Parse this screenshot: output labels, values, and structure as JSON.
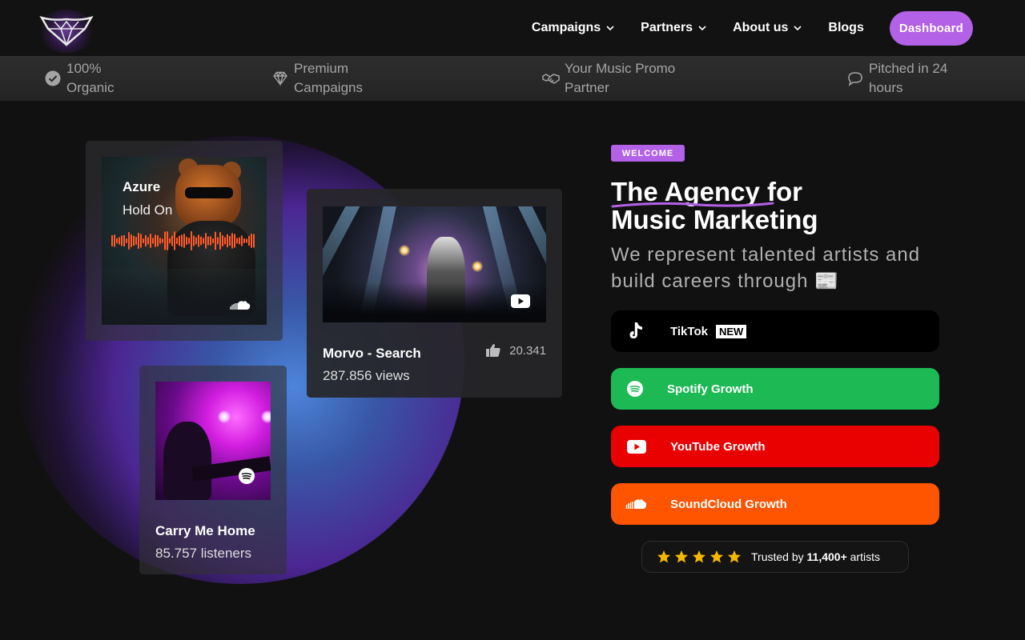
{
  "nav": {
    "items": [
      {
        "label": "Campaigns",
        "has_dropdown": true
      },
      {
        "label": "Partners",
        "has_dropdown": true
      },
      {
        "label": "About us",
        "has_dropdown": true
      },
      {
        "label": "Blogs",
        "has_dropdown": false
      }
    ],
    "cta_label": "Dashboard"
  },
  "features": [
    {
      "icon": "verified-check-icon",
      "line1": "100%",
      "line2": "Organic"
    },
    {
      "icon": "diamond-icon",
      "line1": "Premium",
      "line2": "Campaigns"
    },
    {
      "icon": "handshake-icon",
      "line1": "Your Music Promo",
      "line2": "Partner"
    },
    {
      "icon": "chat-bubble-icon",
      "line1": "Pitched in 24",
      "line2": "hours"
    }
  ],
  "cards": {
    "soundcloud": {
      "artist": "Azure",
      "track": "Hold On"
    },
    "youtube": {
      "title": "Morvo - Search",
      "likes": "20.341",
      "views": "287.856 views"
    },
    "spotify": {
      "title": "Carry Me Home",
      "listeners": "85.757 listeners"
    }
  },
  "hero": {
    "badge": "WELCOME",
    "headline_accent": "The Agency",
    "headline_rest": " for",
    "headline_line2": "Music Marketing",
    "subhead": "We represent talented artists and build careers through 📰"
  },
  "services": [
    {
      "id": "tiktok",
      "label": "TikTok",
      "tag": "NEW",
      "color": "#000000",
      "icon": "tiktok-icon"
    },
    {
      "id": "spotify",
      "label": "Spotify Growth",
      "color": "#1db954",
      "icon": "spotify-icon"
    },
    {
      "id": "youtube",
      "label": "YouTube Growth",
      "color": "#e90000",
      "icon": "youtube-icon"
    },
    {
      "id": "soundcloud",
      "label": "SoundCloud Growth",
      "color": "#ff5500",
      "icon": "soundcloud-icon"
    }
  ],
  "trust": {
    "stars": 5,
    "prefix": "Trusted by ",
    "count": "11,400+",
    "suffix": " artists"
  },
  "colors": {
    "accent": "#b361e6",
    "star": "#f5b800",
    "background": "#111111"
  }
}
